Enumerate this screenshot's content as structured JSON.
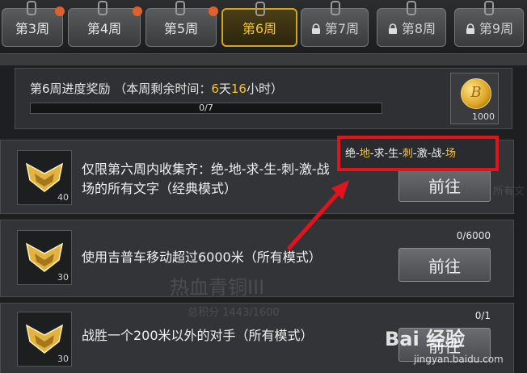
{
  "tabs": [
    {
      "label": "第3周",
      "badge": true,
      "locked": false
    },
    {
      "label": "第4周",
      "badge": true,
      "locked": false
    },
    {
      "label": "第5周",
      "badge": true,
      "locked": false
    },
    {
      "label": "第6周",
      "badge": false,
      "locked": false,
      "active": true
    },
    {
      "label": "第7周",
      "badge": false,
      "locked": true
    },
    {
      "label": "第8周",
      "badge": false,
      "locked": true
    },
    {
      "label": "第9周",
      "badge": false,
      "locked": true
    }
  ],
  "progress": {
    "title_prefix": "第6周进度奖励 （本周剩余时间：",
    "days_value": "6",
    "days_unit": "天",
    "hours_value": "16",
    "hours_unit": "小时）",
    "bar_text": "0/7",
    "fraction": 0,
    "reward_count": "1000"
  },
  "tasks": [
    {
      "text_line1": "仅限第六周内收集齐：绝-地-求-生-刺-激-战",
      "text_line2": "场的所有文字（经典模式）",
      "points": "40",
      "button": "前往",
      "count": ""
    },
    {
      "text_line1": "使用吉普车移动超过6000米（所有模式）",
      "text_line2": "",
      "points": "30",
      "button": "前往",
      "count": "0/6000"
    },
    {
      "text_line1": "战胜一个200米以外的对手（所有模式）",
      "text_line2": "",
      "points": "30",
      "button": "前往",
      "count": "0/1"
    }
  ],
  "callout": {
    "chars": [
      "绝",
      "地",
      "求",
      "生",
      "刺",
      "激",
      "战",
      "场"
    ],
    "highlighted": [
      false,
      true,
      false,
      false,
      true,
      false,
      false,
      true
    ],
    "separator": "-",
    "highlight_color": "#f5c32c",
    "border_color": "#e0141c"
  },
  "watermark": {
    "brand": "Bai 经验",
    "url": "jingyan.baidu.com"
  },
  "background_text": {
    "title": "热血青铜III",
    "score": "总积分 1443/1600",
    "edge": "所有文"
  },
  "colors": {
    "accent": "#f5c32c",
    "badge": "#e0622a"
  },
  "icons": {
    "lock": "lock-icon",
    "coin": "coin-icon",
    "emblem": "rank-emblem-icon"
  }
}
